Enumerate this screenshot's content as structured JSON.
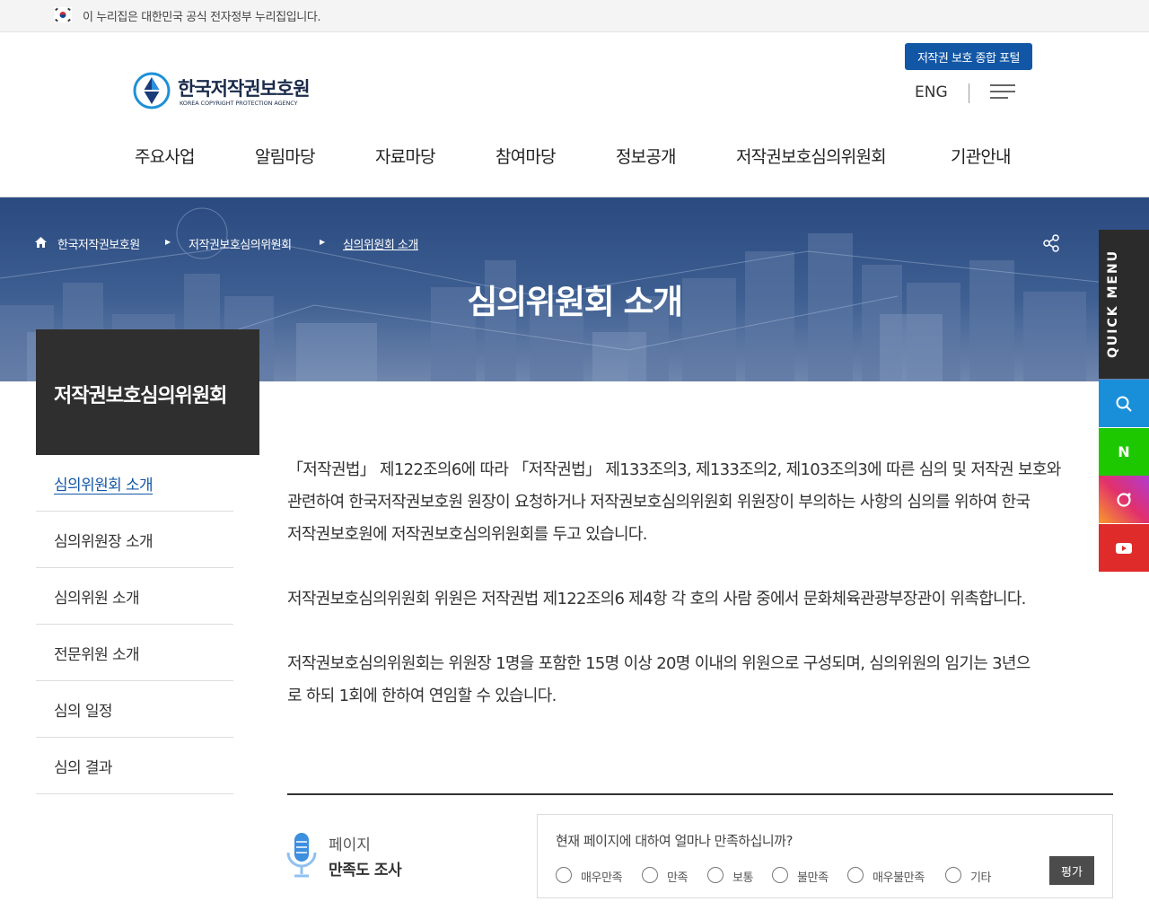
{
  "gov_banner": {
    "text": "이 누리집은 대한민국 공식 전자정부 누리집입니다."
  },
  "header": {
    "logo_name": "한국저작권보호원",
    "logo_sub": "KOREA COPYRIGHT PROTECTION AGENCY",
    "portal_button": "저작권 보호 종합 포털",
    "lang_link": "ENG"
  },
  "gnb": [
    "주요사업",
    "알림마당",
    "자료마당",
    "참여마당",
    "정보공개",
    "저작권보호심의위원회",
    "기관안내"
  ],
  "breadcrumb": [
    "한국저작권보호원",
    "저작권보호심의위원회",
    "심의위원회 소개"
  ],
  "page_title": "심의위원회 소개",
  "quick_menu": {
    "title": "QUICK MENU",
    "naver": "N"
  },
  "lnb": {
    "title": "저작권보호심의위원회",
    "items": [
      "심의위원회 소개",
      "심의위원장 소개",
      "심의위원 소개",
      "전문위원 소개",
      "심의 일정",
      "심의 결과"
    ]
  },
  "content": {
    "p1": "「저작권법」 제122조의6에 따라 「저작권법」 제133조의3, 제133조의2, 제103조의3에 따른 심의 및 저작권 보호와\n관련하여 한국저작권보호원 원장이 요청하거나 저작권보호심의위원회 위원장이 부의하는 사항의 심의를 위하여 한국\n저작권보호원에 저작권보호심의위원회를 두고 있습니다.",
    "p2": "저작권보호심의위원회 위원은 저작권법 제122조의6 제4항 각 호의 사람 중에서 문화체육관광부장관이 위촉합니다.",
    "p3": "저작권보호심의위원회는 위원장 1명을 포함한 15명 이상 20명 이내의 위원으로 구성되며, 심의위원의 임기는 3년으\n로 하되 1회에 한하여 연임할 수 있습니다."
  },
  "survey": {
    "label_1": "페이지",
    "label_2": "만족도 조사",
    "question": "현재 페이지에 대하여 얼마나 만족하십니까?",
    "options": [
      "매우만족",
      "만족",
      "보통",
      "불만족",
      "매우불만족",
      "기타"
    ],
    "submit": "평가"
  },
  "colors": {
    "primary": "#1257a6",
    "dark": "#2f2f2f"
  }
}
